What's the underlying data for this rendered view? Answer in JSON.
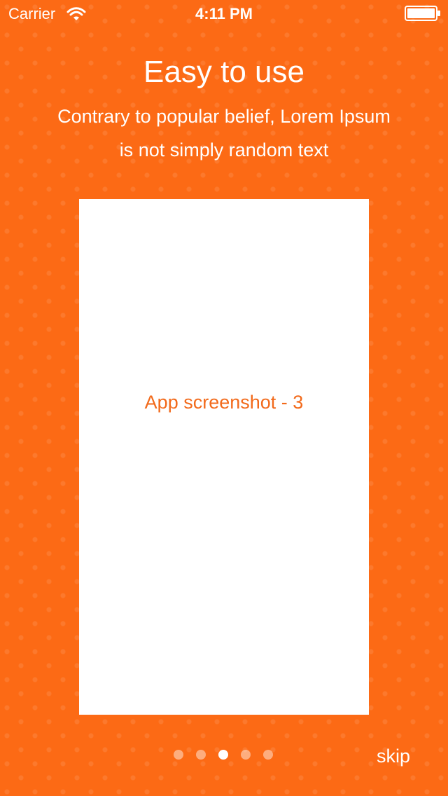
{
  "status_bar": {
    "carrier": "Carrier",
    "time": "4:11 PM"
  },
  "header": {
    "title": "Easy to use",
    "subtitle": "Contrary to popular belief, Lorem Ipsum is not simply random text"
  },
  "screenshot": {
    "label": "App screenshot - 3"
  },
  "pager": {
    "total": 5,
    "current": 3
  },
  "actions": {
    "skip_label": "skip"
  },
  "colors": {
    "background": "#fc6a15",
    "accent_text": "#f26a1b"
  }
}
